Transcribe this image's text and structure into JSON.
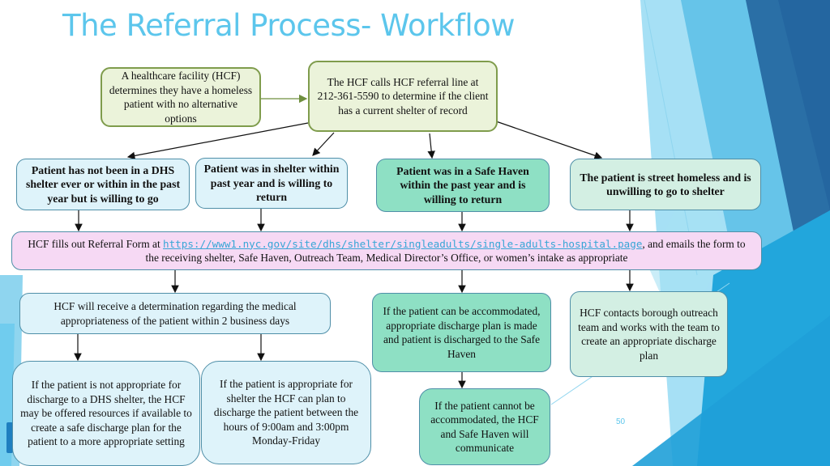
{
  "slide": {
    "title": "The Referral Process- Workflow",
    "page_number": "50",
    "colors": {
      "title": "#5cc6ec",
      "green_box": "#ebf3da",
      "blue_box": "#def3fa",
      "teal_box": "#8ee0c4",
      "mint_box": "#d3efe3",
      "pink_box": "#f6d9f4",
      "link": "#37a6d6"
    }
  },
  "flow": {
    "start": "A healthcare facility (HCF) determines they have a homeless patient with no alternative options",
    "call": "The HCF calls HCF referral line at 212-361-5590 to determine if the client has a current shelter of record",
    "branches": [
      "Patient has not been in a DHS shelter ever or within in the past year but is willing to go",
      "Patient was in shelter within past year and is willing to return",
      "Patient was in a Safe Haven within the past year and is willing to return",
      "The patient is street homeless and is unwilling to go to shelter"
    ],
    "referral": {
      "prefix": "HCF fills out Referral Form at ",
      "link": "https://www1.nyc.gov/site/dhs/shelter/singleadults/single-adults-hospital.page",
      "suffix": ", and emails the form to the receiving shelter, Safe Haven, Outreach Team, Medical Director’s Office, or women’s intake as appropriate"
    },
    "determination": "HCF will receive a determination regarding the medical appropriateness of the patient within 2 business days",
    "safe_haven_yes": "If the patient can be accommodated, appropriate discharge plan is made and patient is discharged to the Safe Haven",
    "outreach": "HCF contacts borough outreach team and works with the team to create an appropriate discharge plan",
    "not_appropriate": "If the patient is not appropriate for discharge to a DHS shelter, the HCF may be offered resources if available to create a safe discharge plan for the patient to a more appropriate setting",
    "appropriate": "If the patient is appropriate for shelter the HCF can plan to discharge the patient between the hours of 9:00am and 3:00pm Monday-Friday",
    "safe_haven_no": "If the patient cannot be accommodated, the HCF and Safe Haven will communicate"
  }
}
